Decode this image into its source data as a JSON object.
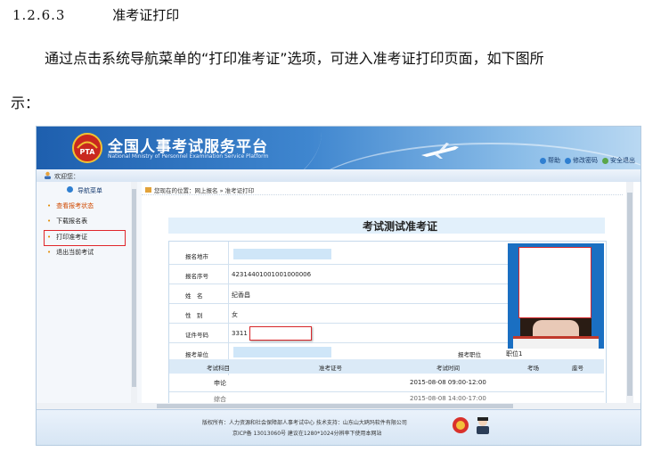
{
  "doc": {
    "section_number": "1.2.6.3",
    "section_title": "准考证打印",
    "para_line1": "通过点击系统导航菜单的“打印准考证”选项，可进入准考证打印页面，如下图所",
    "para_line2": "示："
  },
  "portal": {
    "title": "全国人事考试服务平台",
    "subtitle": "National Ministry of Personnel Examination Service Platform",
    "logo_text": "PTA",
    "top_links": {
      "help": "帮助",
      "change_password": "修改密码",
      "logout": "安全退出"
    },
    "welcome": "欢迎您：",
    "sidebar": {
      "header": "导航菜单",
      "items": [
        "查看报考状态",
        "下载报名表",
        "打印准考证",
        "退出当前考试"
      ],
      "active_index": 0,
      "selected_index": 2
    },
    "breadcrumb": "您现在的位置：网上报名 » 准考证打印",
    "ticket": {
      "title": "考试测试准考证",
      "fields": {
        "location_label": "报名地市",
        "serial_label": "报名序号",
        "serial_value": "42314401001001000006",
        "name_label": "姓　名",
        "name_value": "纪香昌",
        "gender_label": "性　别",
        "gender_value": "女",
        "id_label": "证件号码",
        "id_value": "3311",
        "unit_label": "报考单位",
        "position_label": "报考职位",
        "position_value": "职位1"
      },
      "columns": [
        "考试科目",
        "准考证号",
        "考试时间",
        "考场",
        "座号"
      ],
      "rows": [
        {
          "subject": "申论",
          "ticket_no": "",
          "time": "2015-08-08 09:00-12:00",
          "room": "",
          "seat": ""
        },
        {
          "subject": "综合",
          "ticket_no": "",
          "time": "2015-08-08 14:00-17:00",
          "room": "",
          "seat": ""
        }
      ]
    },
    "footer": {
      "line1": "版权所有：人力资源和社会保障部人事考试中心  技术支持：山东山大鸥玛软件有限公司",
      "line2": "京ICP备 13013060号  建议在1280*1024分辨率下使用本网站"
    },
    "colors": {
      "banner_dark": "#1e5fae",
      "banner_light": "#b9d8f2",
      "accent_red": "#e0262b"
    }
  }
}
